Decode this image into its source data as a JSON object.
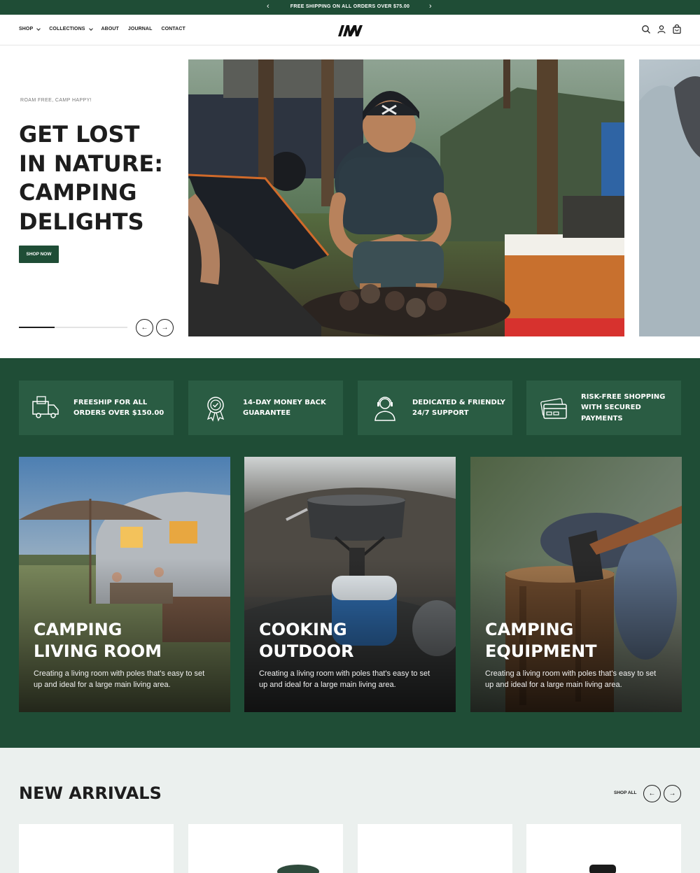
{
  "announcement": {
    "text": "FREE SHIPPING ON ALL ORDERS OVER $75.00",
    "prev": "‹",
    "next": "›"
  },
  "nav": {
    "items": [
      {
        "label": "SHOP",
        "dropdown": true
      },
      {
        "label": "COLLECTIONS",
        "dropdown": true
      },
      {
        "label": "ABOUT",
        "dropdown": false
      },
      {
        "label": "JOURNAL",
        "dropdown": false
      },
      {
        "label": "CONTACT",
        "dropdown": false
      }
    ],
    "icons": [
      "search-icon",
      "account-icon",
      "cart-icon"
    ]
  },
  "hero": {
    "eyebrow": "ROAM FREE, CAMP HAPPY!",
    "title": "GET LOST IN NATURE: CAMPING DELIGHTS",
    "cta": "SHOP NOW",
    "prev": "←",
    "next": "→",
    "progress": 0.33
  },
  "features": [
    {
      "icon": "delivery-truck-icon",
      "text": "FREESHIP FOR ALL ORDERS OVER $150.00"
    },
    {
      "icon": "award-badge-icon",
      "text": "14-DAY MONEY BACK GUARANTEE"
    },
    {
      "icon": "support-agent-icon",
      "text": "DEDICATED & FRIENDLY 24/7 SUPPORT"
    },
    {
      "icon": "credit-card-icon",
      "text": "RISK-FREE SHOPPING WITH SECURED PAYMENTS"
    }
  ],
  "categories": [
    {
      "title": "CAMPING LIVING ROOM",
      "desc": "Creating a living room with poles that's easy to set up and ideal for a large main living area."
    },
    {
      "title": "COOKING OUTDOOR",
      "desc": "Creating a living room with poles that's easy to set up and ideal for a large main living area."
    },
    {
      "title": "CAMPING EQUIPMENT",
      "desc": "Creating a living room with poles that's easy to set up and ideal for a large main living area."
    }
  ],
  "arrivals": {
    "title": "NEW ARRIVALS",
    "shop_all": "SHOP ALL",
    "prev": "←",
    "next": "→"
  },
  "colors": {
    "brand_green": "#1f4d36",
    "feature_green": "#2a5c43",
    "arrivals_bg": "#ebf0ee"
  }
}
